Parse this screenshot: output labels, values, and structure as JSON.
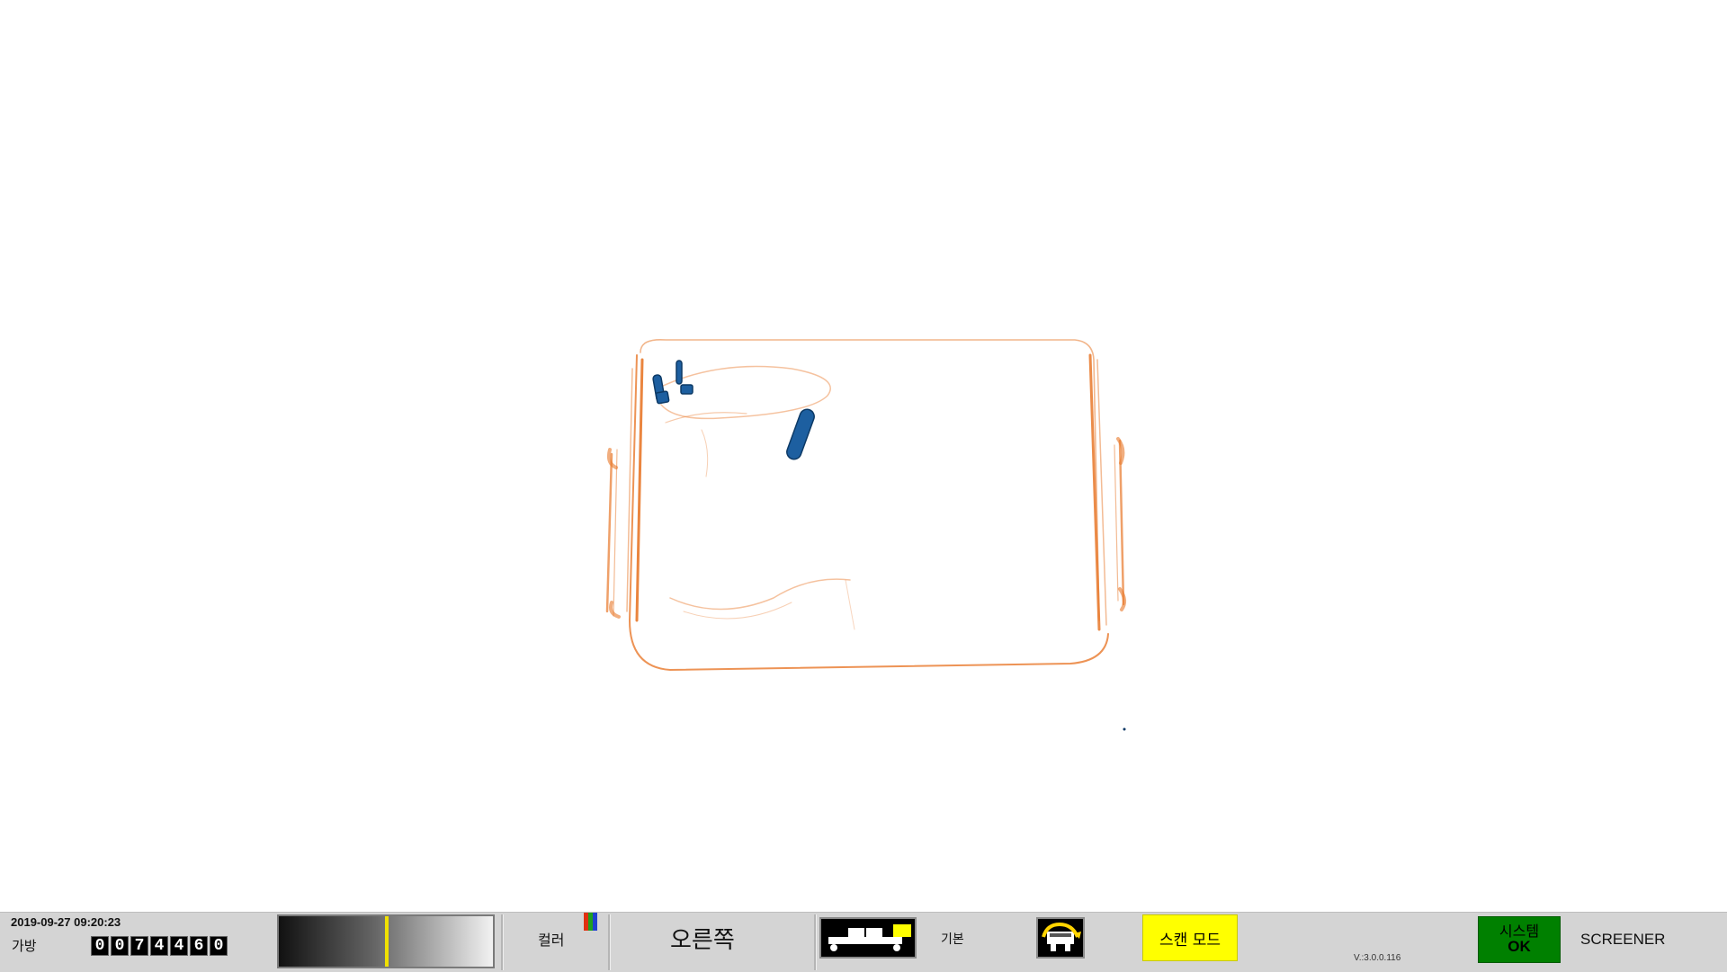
{
  "status_bar": {
    "datetime": "2019-09-27 09:20:23",
    "bag_label": "가방",
    "bag_count_digits": [
      "0",
      "0",
      "7",
      "4",
      "4",
      "6",
      "0"
    ],
    "color_label": "컬러",
    "color_bar_colors": [
      "#e03010",
      "#20a020",
      "#2040d0"
    ],
    "direction_label": "오른쪽",
    "profile_label": "기본",
    "scan_mode_button": "스캔 모드",
    "version": "V.:3.0.0.116",
    "system_status_title": "시스템",
    "system_status_value": "OK",
    "user_role": "SCREENER"
  },
  "colors": {
    "organic": "#e8782a",
    "metal": "#1d5fa0",
    "scan_button": "#ffff00",
    "system_ok": "#008000",
    "gradient_marker": "#f0e000"
  },
  "icons": {
    "mode": "conveyor-mode-icon",
    "belt": "belt-direction-icon"
  }
}
